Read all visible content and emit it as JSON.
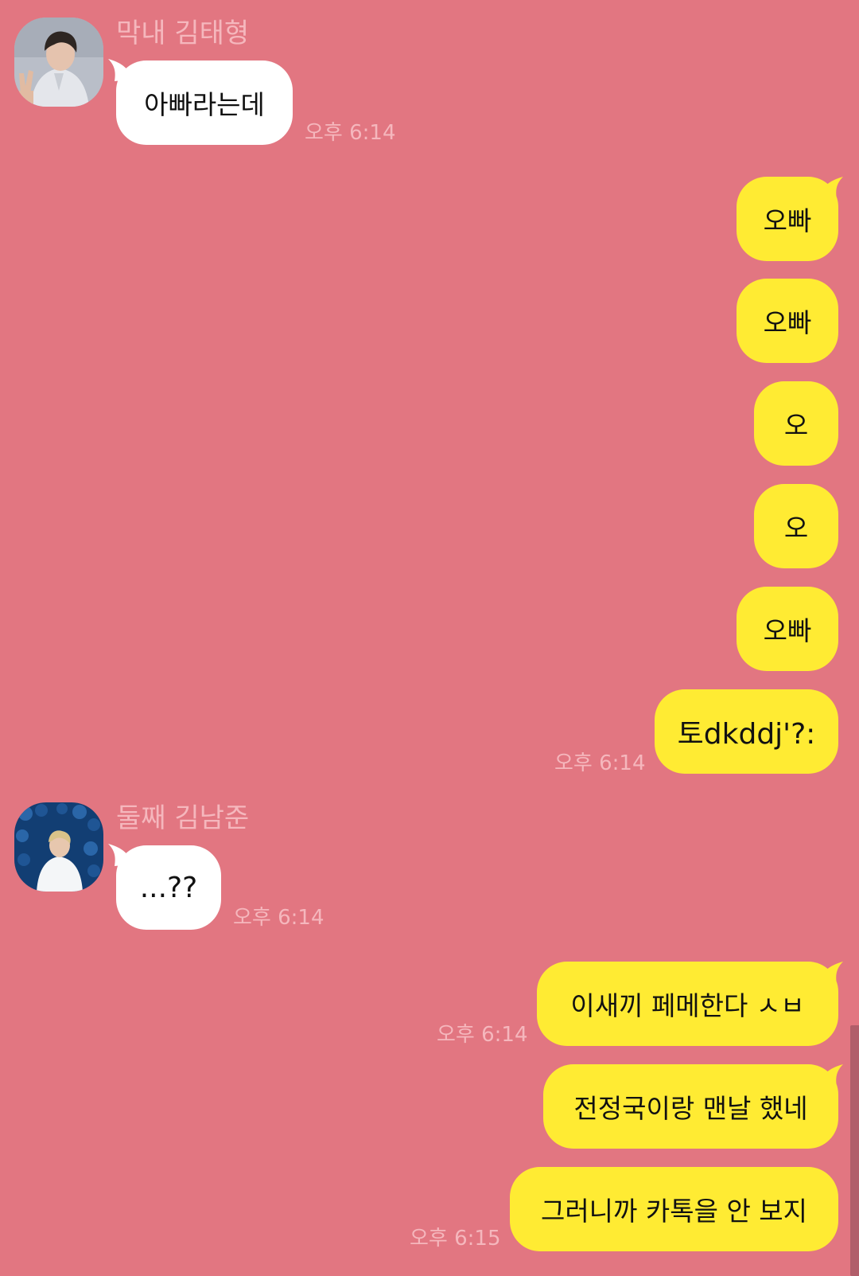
{
  "theme": {
    "background": "#E27681",
    "incoming_bubble": "#FFFFFF",
    "outgoing_bubble": "#FFEB33",
    "meta_text": "#F5B7BD"
  },
  "messages": {
    "m1": {
      "sender": "막내 김태형",
      "avatar": "avatar-photo-icon",
      "text": "아빠라는데",
      "time": "오후 6:14"
    },
    "m2": {
      "text": "오빠"
    },
    "m3": {
      "text": "오빠"
    },
    "m4": {
      "text": "오"
    },
    "m5": {
      "text": "오"
    },
    "m6": {
      "text": "오빠"
    },
    "m7": {
      "text": "토dkddj'?:",
      "time": "오후 6:14"
    },
    "m8": {
      "sender": "둘째 김남준",
      "avatar": "avatar-photo-icon",
      "text": "...??",
      "time": "오후 6:14"
    },
    "m9": {
      "text": "이새끼 페메한다 ㅅㅂ",
      "time": "오후 6:14"
    },
    "m10": {
      "text": "전정국이랑 맨날 했네"
    },
    "m11": {
      "text": "그러니까 카톡을 안 보지",
      "time": "오후 6:15"
    }
  }
}
